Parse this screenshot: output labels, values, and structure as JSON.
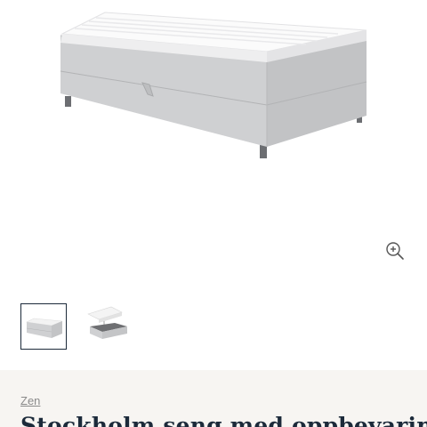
{
  "gallery": {
    "main_image": "bed-frame-product-photo",
    "zoom_icon": "zoom-in-icon"
  },
  "thumbnails": [
    {
      "name": "bed-closed-photo",
      "active": true
    },
    {
      "name": "bed-storage-open-photo",
      "active": false
    }
  ],
  "product": {
    "brand": "Zen",
    "title": "Stockholm seng med oppbevaring"
  },
  "colors": {
    "title": "#1c2a3a",
    "info_background": "#f7f5f2",
    "upholstery": "#cfd0d2"
  }
}
